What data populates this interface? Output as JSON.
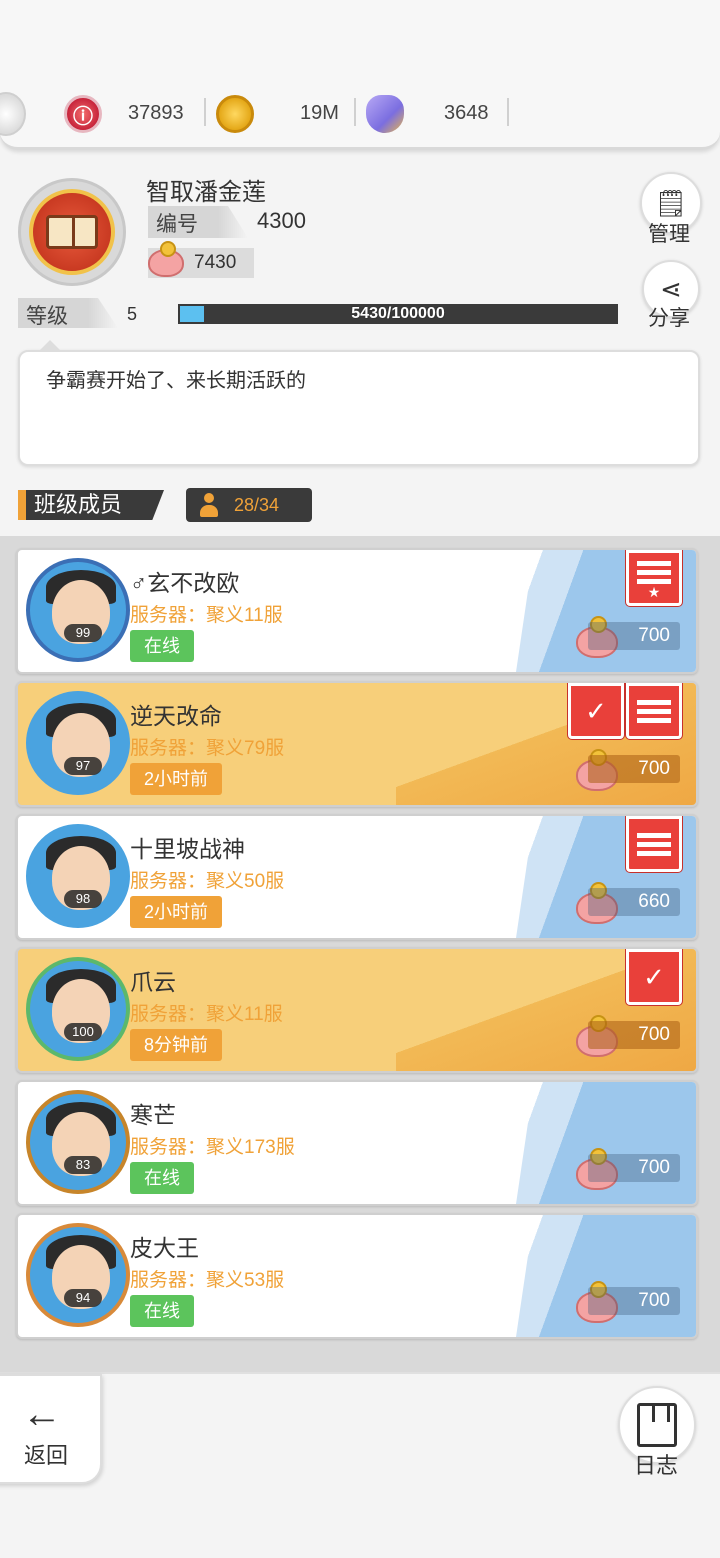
{
  "resources": {
    "items": [
      {
        "icon": "red-gem-icon",
        "value": "37893"
      },
      {
        "icon": "gold-coin-icon",
        "value": "19M"
      },
      {
        "icon": "crystal-icon",
        "value": "3648"
      }
    ]
  },
  "profile": {
    "name": "智取潘金莲",
    "id_label": "编号",
    "id_value": "4300",
    "funds": "7430",
    "level_label": "等级",
    "level": "5",
    "xp_text": "5430/100000",
    "xp_fraction": 0.0543,
    "manage_label": "管理",
    "share_label": "分享"
  },
  "notice": {
    "text": "争霸赛开始了、来长期活跃的"
  },
  "members_section": {
    "title": "班级成员",
    "count": "28/34"
  },
  "members": [
    {
      "name": "♂玄不改欧",
      "server": "服务器：聚义11服",
      "status": "在线",
      "online": true,
      "level": "99",
      "coins": "700",
      "style": "white",
      "badges": [
        "rank"
      ]
    },
    {
      "name": "逆天改命",
      "server": "服务器：聚义79服",
      "status": "2小时前",
      "online": false,
      "level": "97",
      "coins": "700",
      "style": "gold",
      "badges": [
        "shield",
        "rank"
      ]
    },
    {
      "name": "十里坡战神",
      "server": "服务器：聚义50服",
      "status": "2小时前",
      "online": false,
      "level": "98",
      "coins": "660",
      "style": "white",
      "badges": [
        "rank"
      ]
    },
    {
      "name": "爪云",
      "server": "服务器：聚义11服",
      "status": "8分钟前",
      "online": false,
      "level": "100",
      "coins": "700",
      "style": "gold",
      "badges": [
        "shield"
      ]
    },
    {
      "name": "寒芒",
      "server": "服务器：聚义173服",
      "status": "在线",
      "online": true,
      "level": "83",
      "coins": "700",
      "style": "white",
      "badges": []
    },
    {
      "name": "皮大王",
      "server": "服务器：聚义53服",
      "status": "在线",
      "online": true,
      "level": "94",
      "coins": "700",
      "style": "white",
      "badges": []
    }
  ],
  "bottom": {
    "back_label": "返回",
    "log_label": "日志"
  }
}
